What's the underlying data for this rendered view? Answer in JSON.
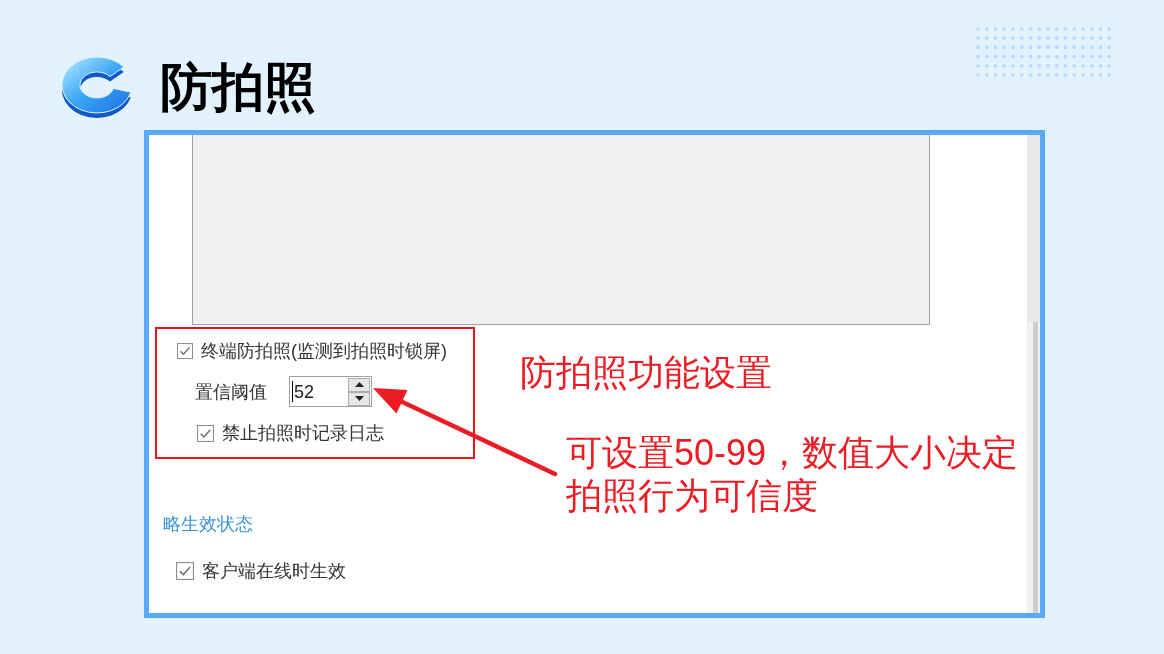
{
  "header": {
    "title": "防拍照"
  },
  "screenshot": {
    "anti_photo": {
      "enabled": {
        "label": "终端防拍照(监测到拍照时锁屏)",
        "checked": true
      },
      "threshold": {
        "label": "置信阈值",
        "value": "52"
      },
      "no_log": {
        "label": "禁止拍照时记录日志",
        "checked": true
      }
    },
    "effect_status": {
      "title": "略生效状态",
      "options": [
        {
          "label": "客户端在线时生效",
          "checked": true
        }
      ]
    }
  },
  "annotations": [
    {
      "text": "防拍照功能设置"
    },
    {
      "text": "可设置50-99，数值大小决定拍照行为可信度"
    }
  ]
}
